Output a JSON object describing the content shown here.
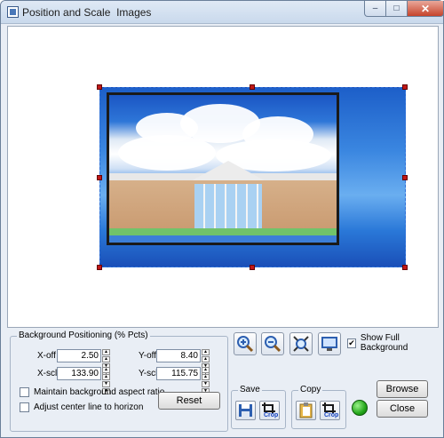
{
  "window": {
    "title": "Position and Scale  Images",
    "minimize_glyph": "–",
    "maximize_glyph": "□",
    "close_glyph": "✕"
  },
  "positioning": {
    "group_title": "Background Positioning (% Pcts)",
    "xoff_label": "X-off",
    "xoff_value": "2.50",
    "yoff_label": "Y-off",
    "yoff_value": "8.40",
    "xscl_label": "X-scl",
    "xscl_value": "133.90",
    "yscl_label": "Y-scl",
    "yscl_value": "115.75",
    "maintain_aspect_label": "Maintain background aspect ratio",
    "maintain_aspect_checked": false,
    "adjust_center_label": "Adjust center line to horizon",
    "adjust_center_checked": false,
    "reset_label": "Reset"
  },
  "toolbar": {
    "show_full_label": "Show Full Background",
    "show_full_checked": true,
    "save_title": "Save",
    "copy_title": "Copy",
    "crop_label": "Crop",
    "browse_label": "Browse",
    "close_label": "Close"
  },
  "colors": {
    "handle": "#c01818",
    "frame_border": "#2e6fd8",
    "status_led": "#23a61a"
  }
}
